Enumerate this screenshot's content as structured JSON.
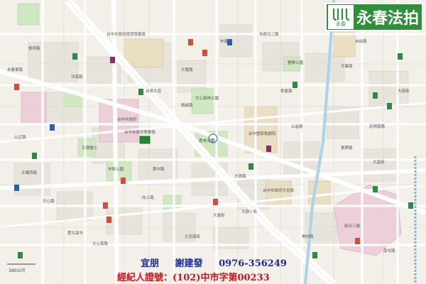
{
  "map": {
    "place_labels": [
      "台中市政府",
      "台中市政府經濟發展局",
      "台中市政府文化局",
      "惠來公園",
      "豐樂公園",
      "台中國家歌劇院",
      "文心森林公園",
      "大墩國小",
      "台中市政府警察局",
      "市政公園",
      "惠文高中",
      "新光三越",
      "大隆路",
      "五權西路",
      "文心路",
      "河南路",
      "台灣大道",
      "市政北二路",
      "公益路",
      "大業路",
      "自由路",
      "大墩路",
      "向上路",
      "忠明南路",
      "精誠路",
      "大進街",
      "黎明路",
      "惠中路",
      "市政路",
      "東興路",
      "大昌街",
      "南屯路",
      "美村路",
      "大忠南街",
      "永春東路",
      "文心南路",
      "公正路",
      "大英街",
      "寧夏路",
      "大墩十街"
    ],
    "scale_text": "380公尺"
  },
  "badge": {
    "logo_text": "永春",
    "name": "永春法拍"
  },
  "contact": {
    "label": "宜朋",
    "name": "謝建發",
    "phone": "0976-356249"
  },
  "license": {
    "text": "經紀人證號：(102)中市字第00233"
  }
}
